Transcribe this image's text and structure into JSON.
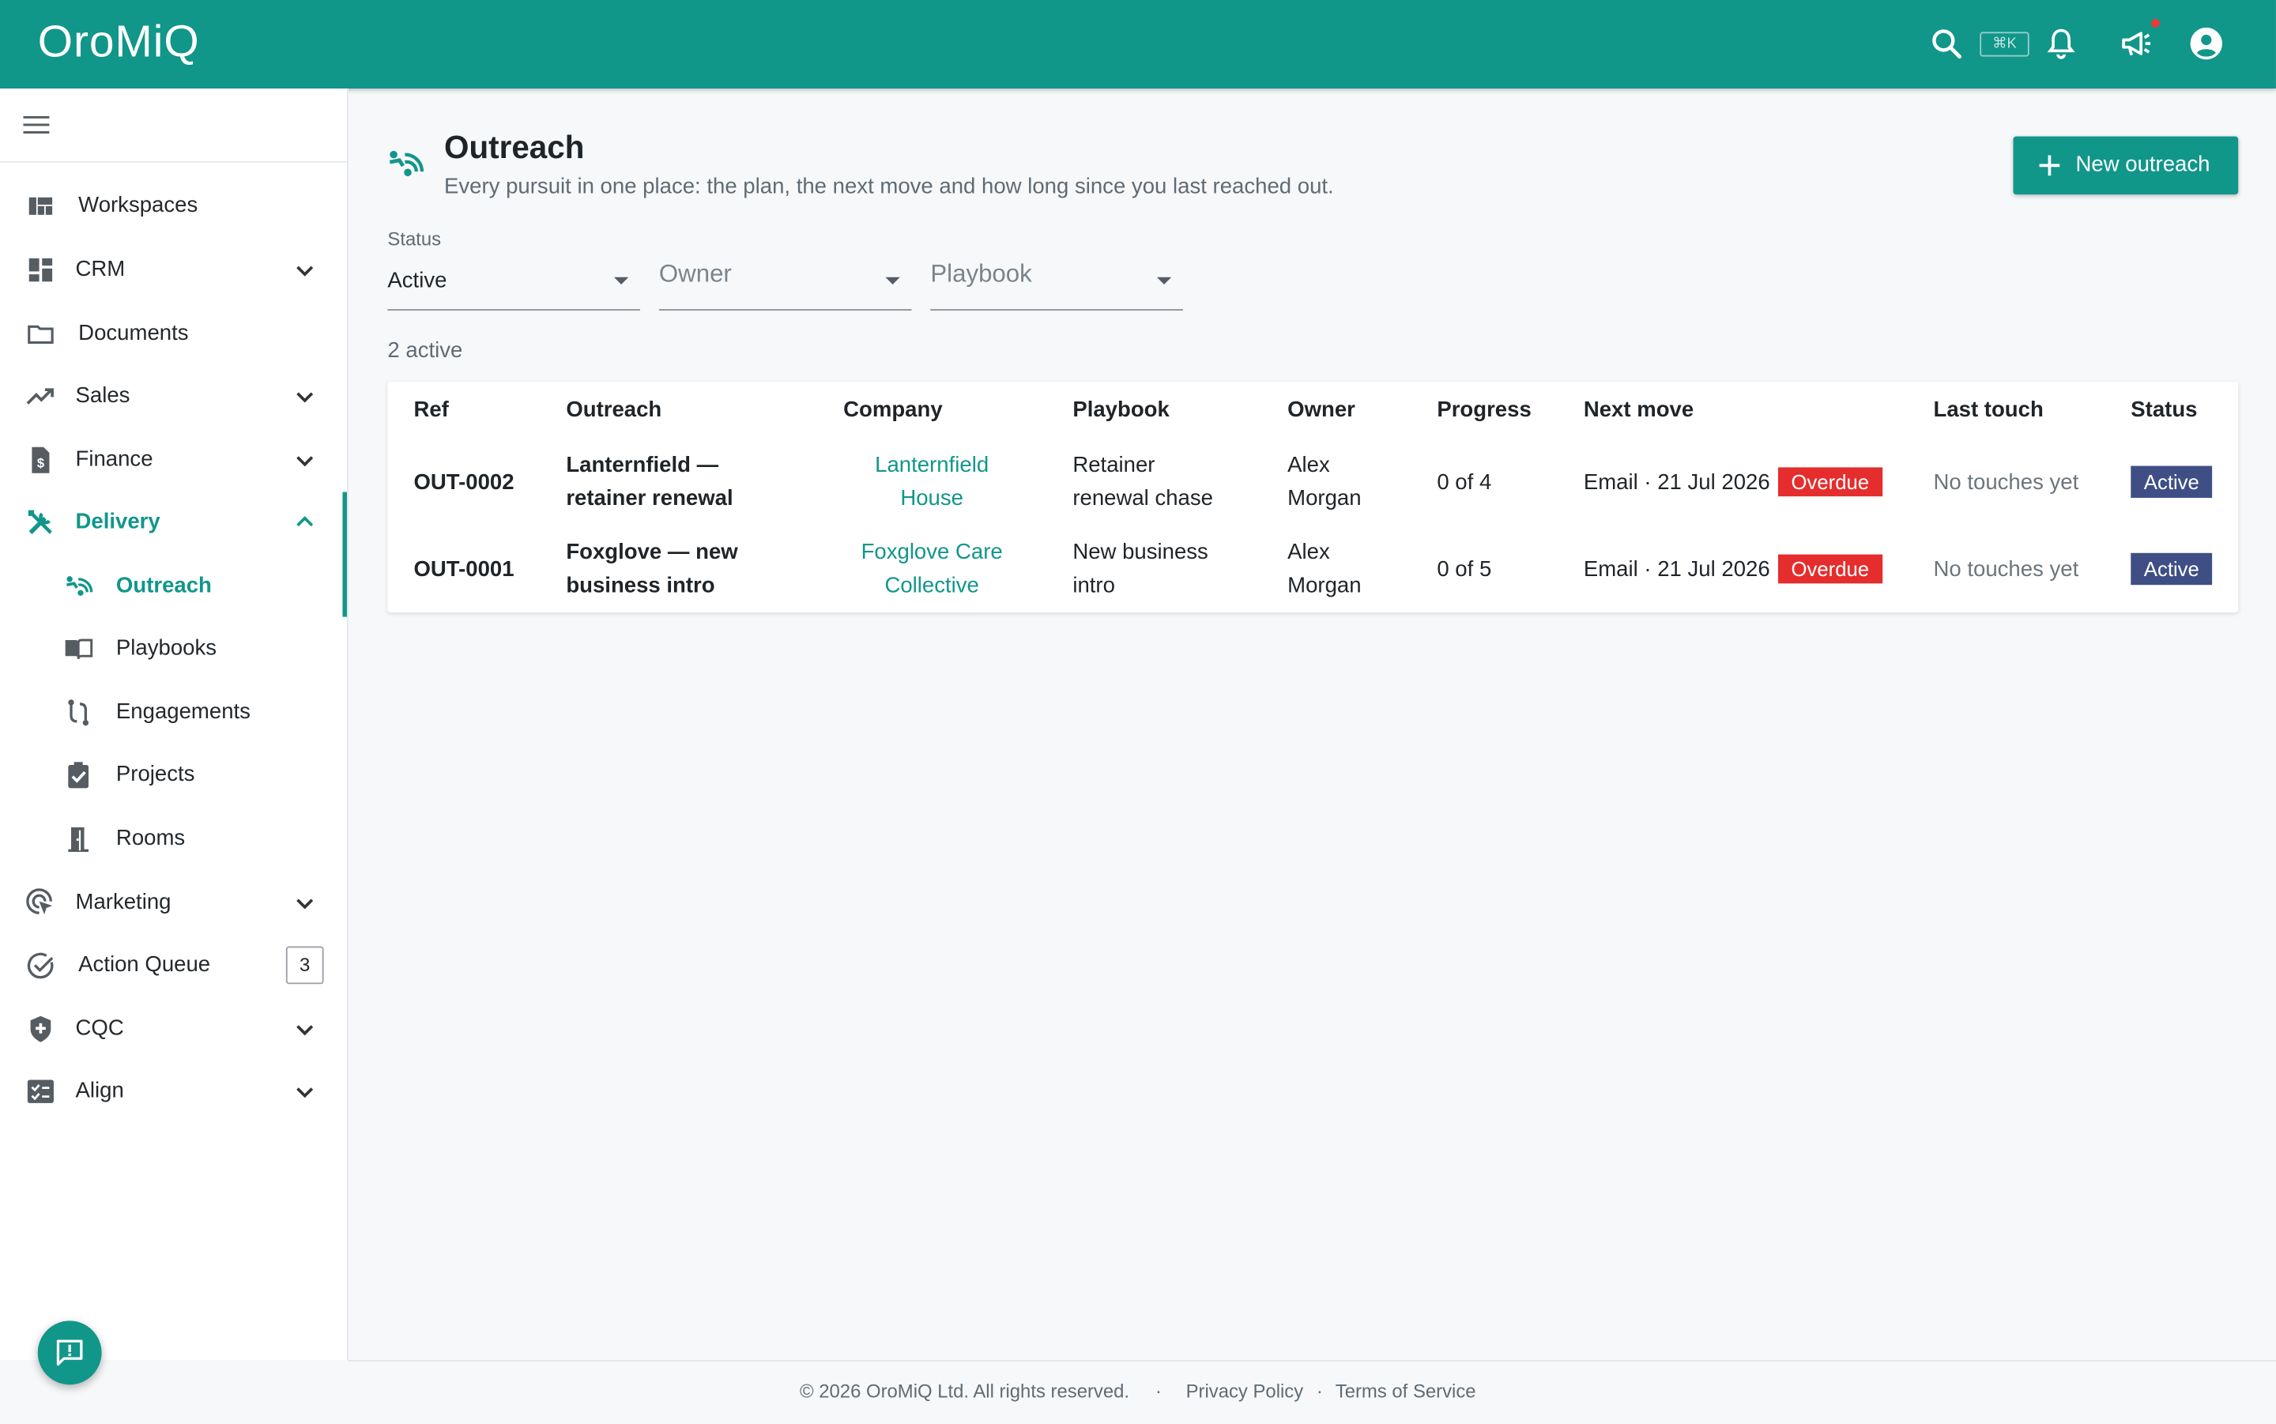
{
  "app": {
    "name": "OroMiQ",
    "shortcut": "⌘K"
  },
  "sidebar": {
    "items": [
      {
        "label": "Workspaces",
        "icon": "workspaces-icon"
      },
      {
        "label": "CRM",
        "icon": "dashboard-icon"
      },
      {
        "label": "Documents",
        "icon": "folder-icon"
      },
      {
        "label": "Sales",
        "icon": "trending-up-icon"
      },
      {
        "label": "Finance",
        "icon": "invoice-icon"
      },
      {
        "label": "Delivery",
        "icon": "tools-icon"
      },
      {
        "label": "Marketing",
        "icon": "target-icon"
      },
      {
        "label": "Action Queue",
        "icon": "check-circle-icon",
        "badge": "3"
      },
      {
        "label": "CQC",
        "icon": "shield-icon"
      },
      {
        "label": "Align",
        "icon": "checklist-icon"
      }
    ],
    "delivery_children": [
      {
        "label": "Outreach",
        "icon": "outreach-icon"
      },
      {
        "label": "Playbooks",
        "icon": "book-icon"
      },
      {
        "label": "Engagements",
        "icon": "route-icon"
      },
      {
        "label": "Projects",
        "icon": "clipboard-check-icon"
      },
      {
        "label": "Rooms",
        "icon": "door-icon"
      }
    ]
  },
  "page": {
    "title": "Outreach",
    "subtitle": "Every pursuit in one place: the plan, the next move and how long since you last reached out.",
    "new_button": "New outreach"
  },
  "filters": {
    "status_label": "Status",
    "status_value": "Active",
    "owner_placeholder": "Owner",
    "playbook_placeholder": "Playbook"
  },
  "count_text": "2 active",
  "table": {
    "headers": {
      "ref": "Ref",
      "outreach": "Outreach",
      "company": "Company",
      "playbook": "Playbook",
      "owner": "Owner",
      "progress": "Progress",
      "next": "Next move",
      "last": "Last touch",
      "status": "Status"
    },
    "rows": [
      {
        "ref": "OUT-0002",
        "outreach": [
          "Lanternfield —",
          "retainer renewal"
        ],
        "company": [
          "Lanternfield",
          "House"
        ],
        "playbook": [
          "Retainer",
          "renewal chase"
        ],
        "owner": [
          "Alex",
          "Morgan"
        ],
        "progress": "0 of 4",
        "next": "Email · 21 Jul 2026",
        "next_badge": "Overdue",
        "last": "No touches yet",
        "status": "Active"
      },
      {
        "ref": "OUT-0001",
        "outreach": [
          "Foxglove — new",
          "business intro"
        ],
        "company": [
          "Foxglove Care",
          "Collective"
        ],
        "playbook": [
          "New business",
          "intro"
        ],
        "owner": [
          "Alex",
          "Morgan"
        ],
        "progress": "0 of 5",
        "next": "Email · 21 Jul 2026",
        "next_badge": "Overdue",
        "last": "No touches yet",
        "status": "Active"
      }
    ]
  },
  "footer": {
    "copyright": "© 2026 OroMiQ Ltd. All rights reserved.",
    "sep": "·",
    "privacy": "Privacy Policy",
    "terms": "Terms of Service"
  },
  "colors": {
    "brand": "#11968a",
    "overdue": "#e52d2d",
    "active_badge": "#3f4f86"
  }
}
